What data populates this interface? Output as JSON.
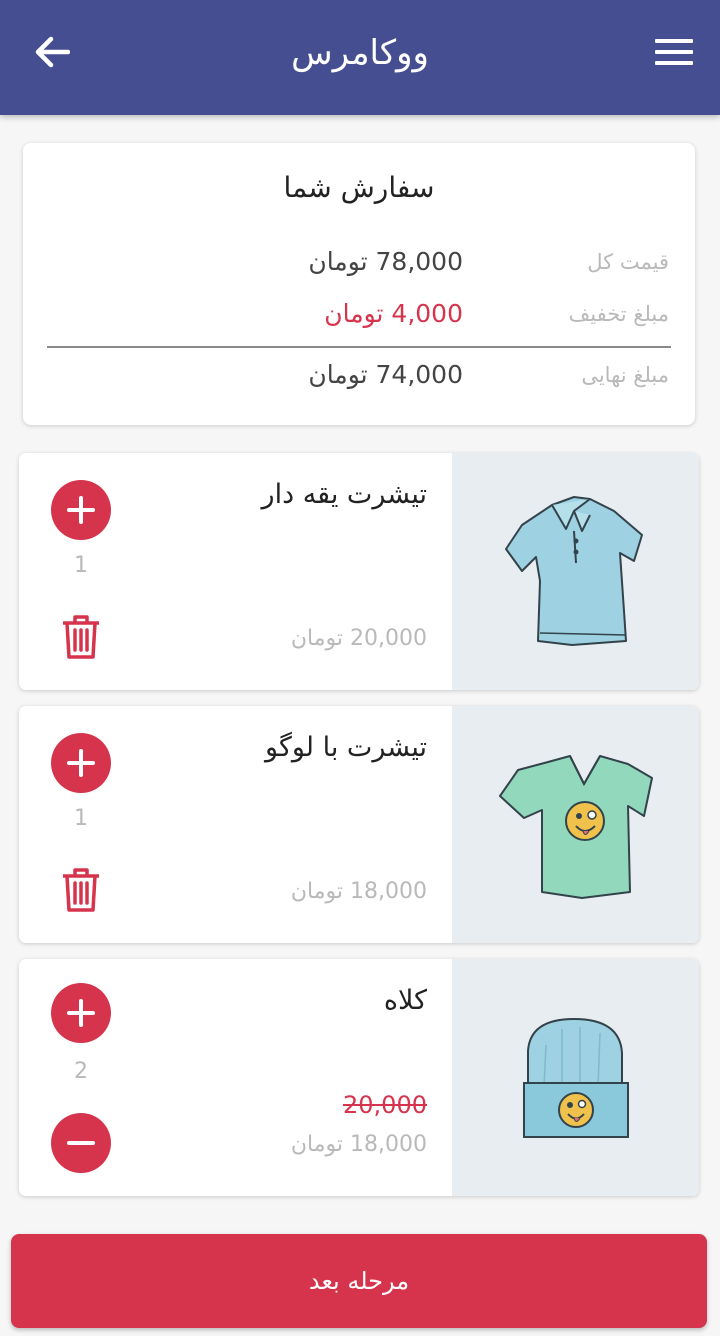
{
  "app": {
    "title": "ووکامرس",
    "accent": "#454e90",
    "primary": "#d6344c"
  },
  "summary": {
    "title": "سفارش شما",
    "rows": [
      {
        "label": "قیمت کل",
        "value": "78,000 تومان"
      },
      {
        "label": "مبلغ تخفیف",
        "value": "4,000 تومان"
      },
      {
        "label": "مبلغ نهایی",
        "value": "74,000 تومان"
      }
    ]
  },
  "cart": [
    {
      "name": "تیشرت یقه دار",
      "price": "20,000  تومان",
      "quantity": "1",
      "image": "polo-shirt-icon"
    },
    {
      "name": "تیشرت با لوگو",
      "price": "18,000  تومان",
      "quantity": "1",
      "image": "logo-tshirt-icon"
    },
    {
      "name": "کلاه",
      "old_price": "20,000",
      "price": "18,000  تومان",
      "quantity": "2",
      "image": "beanie-icon"
    }
  ],
  "next_button": "مرحله بعد"
}
